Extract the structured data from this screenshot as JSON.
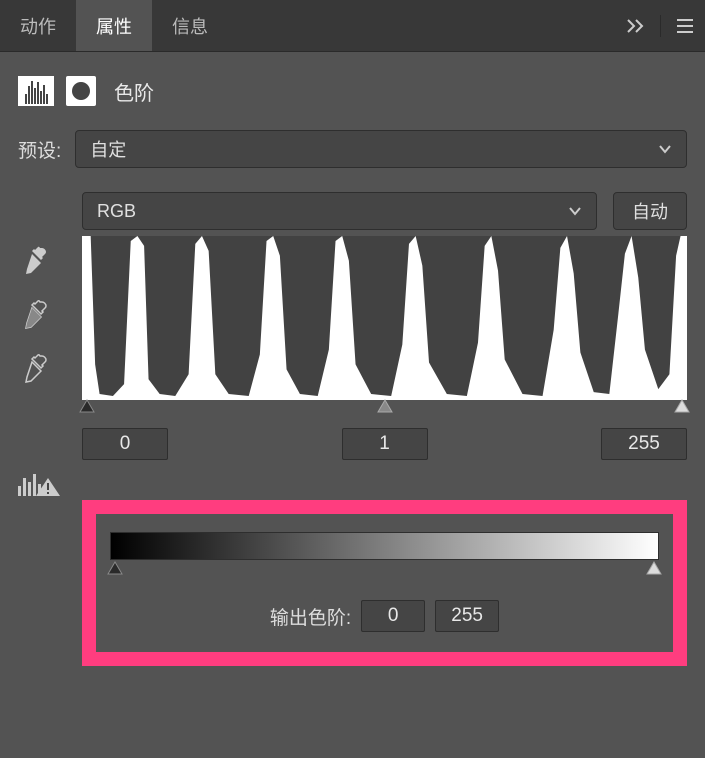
{
  "tabs": {
    "actions": "动作",
    "properties": "属性",
    "info": "信息"
  },
  "title": "色阶",
  "preset": {
    "label": "预设:",
    "value": "自定"
  },
  "channel": {
    "value": "RGB",
    "auto": "自动"
  },
  "input_levels": {
    "black": "0",
    "mid": "1",
    "white": "255"
  },
  "output": {
    "label": "输出色阶:",
    "black": "0",
    "white": "255"
  }
}
